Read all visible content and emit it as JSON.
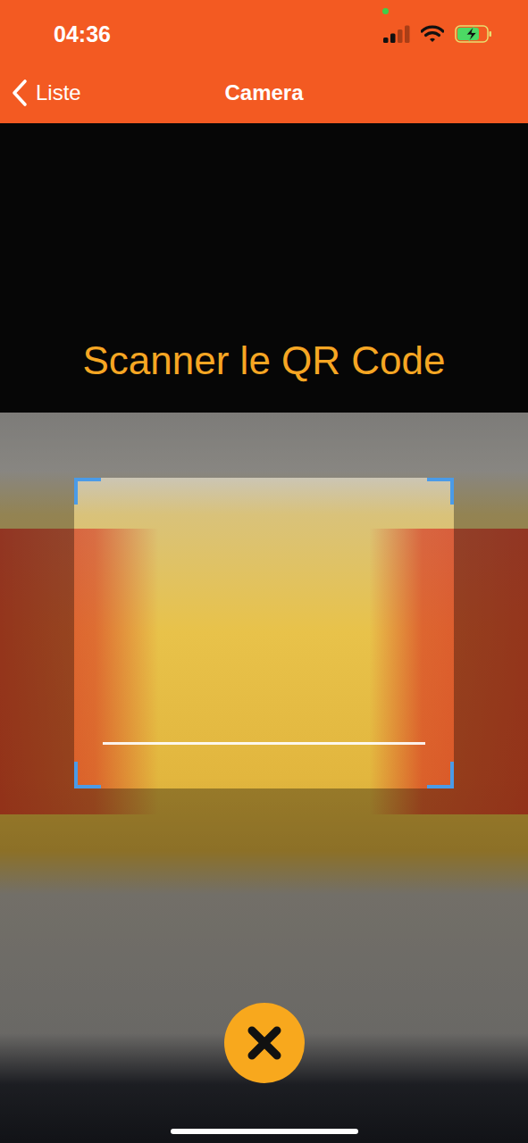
{
  "status_bar": {
    "time": "04:36",
    "privacy_indicator": {
      "on": true,
      "color": "#3ecf4a"
    },
    "signal": {
      "level": 0.5
    },
    "wifi": {
      "on": true
    },
    "battery": {
      "level": 0.75,
      "charging": true
    }
  },
  "nav_bar": {
    "back": {
      "label": "Liste"
    },
    "title": "Camera"
  },
  "scanner": {
    "prompt": "Scanner le QR Code",
    "scan_line": {
      "level": 0.85
    }
  }
}
